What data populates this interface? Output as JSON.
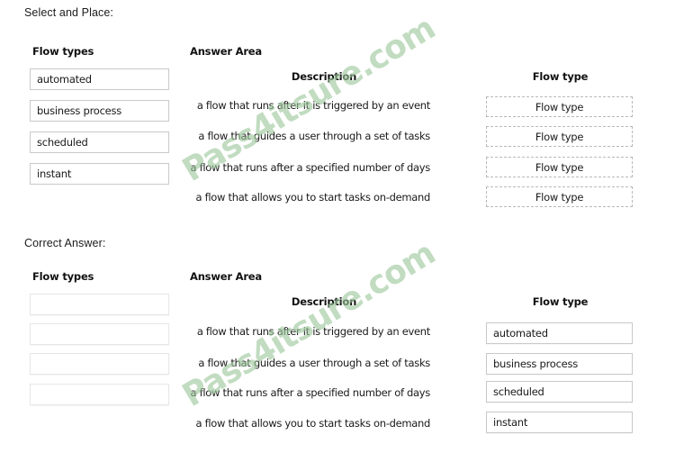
{
  "sections": [
    {
      "label": "Select and Place:",
      "left_column_heading": "Flow types",
      "answer_area_heading": "Answer Area",
      "description_heading": "Description",
      "flow_type_heading": "Flow type",
      "source_tiles": [
        "automated",
        "business process",
        "scheduled",
        "instant"
      ],
      "descriptions": [
        "a flow that runs after it is triggered by an event",
        "a flow that guides a user through a set of tasks",
        "a flow that runs after a specified number of days",
        "a flow that allows you to start tasks on-demand"
      ],
      "targets": [
        "Flow type",
        "Flow type",
        "Flow type",
        "Flow type"
      ]
    },
    {
      "label": "Correct Answer:",
      "left_column_heading": "Flow types",
      "answer_area_heading": "Answer Area",
      "description_heading": "Description",
      "flow_type_heading": "Flow type",
      "source_tiles": [
        "",
        "",
        "",
        ""
      ],
      "descriptions": [
        "a flow that runs after it is triggered by an event",
        "a flow that guides a user through a set of tasks",
        "a flow that runs after a specified number of days",
        "a flow that allows you to start tasks on-demand"
      ],
      "targets": [
        "automated",
        "business process",
        "scheduled",
        "instant"
      ]
    }
  ],
  "watermark": {
    "text": "Pass4itsure.com",
    "color": "#9cc79a"
  }
}
